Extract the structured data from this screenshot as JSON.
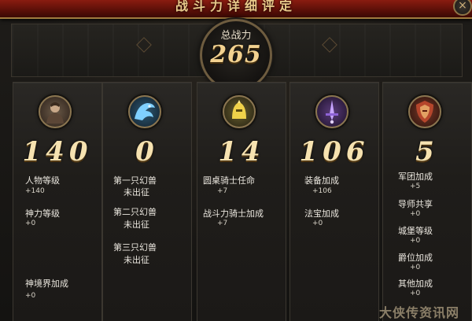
{
  "window": {
    "title": "战斗力详细评定",
    "close_glyph": "×"
  },
  "total_power": {
    "label": "总战力",
    "value": "265"
  },
  "columns": [
    {
      "value": "140",
      "icon": "warrior-portrait-icon",
      "entries": [
        {
          "label": "人物等级",
          "value": "+140"
        },
        {
          "label": "神力等级",
          "value": "+0"
        },
        {
          "label": "神境界加成",
          "value": "+0"
        }
      ]
    },
    {
      "value": "0",
      "icon": "blue-dragon-icon",
      "entries": [
        {
          "label": "第一只幻兽",
          "value": "未出征"
        },
        {
          "label": "第二只幻兽",
          "value": "未出征"
        },
        {
          "label": "第三只幻兽",
          "value": "未出征"
        }
      ]
    },
    {
      "value": "14",
      "icon": "golden-helmet-icon",
      "entries": [
        {
          "label": "圆桌骑士任命",
          "value": "+7"
        },
        {
          "label": "战斗力骑士加成",
          "value": "+7"
        }
      ]
    },
    {
      "value": "106",
      "icon": "purple-sword-icon",
      "entries": [
        {
          "label": "装备加成",
          "value": "+106"
        },
        {
          "label": "法宝加成",
          "value": "+0"
        }
      ]
    },
    {
      "value": "5",
      "icon": "legion-shield-icon",
      "entries": [
        {
          "label": "军团加成",
          "value": "+5"
        },
        {
          "label": "导师共享",
          "value": "+0"
        },
        {
          "label": "城堡等级",
          "value": "+0"
        },
        {
          "label": "爵位加成",
          "value": "+0"
        },
        {
          "label": "其他加成",
          "value": "+0"
        }
      ]
    }
  ],
  "watermark": "大侠传资讯网"
}
